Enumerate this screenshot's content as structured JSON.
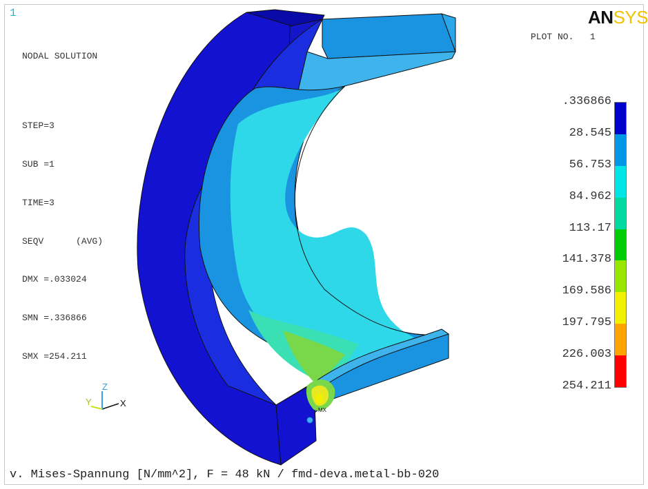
{
  "window_number": "1",
  "info": {
    "title": "NODAL SOLUTION",
    "step": "STEP=3",
    "sub": "SUB =1",
    "time": "TIME=3",
    "seqv": "SEQV      (AVG)",
    "dmx": "DMX =.033024",
    "smn": "SMN =.336866",
    "smx": "SMX =254.211"
  },
  "logo": {
    "an": "AN",
    "sys": "SYS"
  },
  "plot_no": "PLOT NO.   1",
  "legend": {
    "ticks": [
      ".336866",
      "28.545",
      "56.753",
      "84.962",
      "113.17",
      "141.378",
      "169.586",
      "197.795",
      "226.003",
      "254.211"
    ],
    "colors": [
      "#0000cc",
      "#0098e6",
      "#00e6e6",
      "#00d9a0",
      "#00cc00",
      "#99e600",
      "#f0f000",
      "#ffa500",
      "#ff0000"
    ]
  },
  "model": {
    "colors": {
      "dark_blue": "#1212d0",
      "blue": "#1a93e0",
      "light_blue": "#3fb3ec",
      "cyan": "#2fd8e8",
      "teal": "#3ae0b4",
      "green": "#78d84a",
      "yellow": "#e8e820",
      "outline": "#111111"
    },
    "marker": "MX"
  },
  "triad": {
    "x": "X",
    "y": "Y",
    "z": "Z"
  },
  "footer": "v. Mises-Spannung [N/mm^2], F = 48 kN / fmd-deva.metal-bb-020"
}
